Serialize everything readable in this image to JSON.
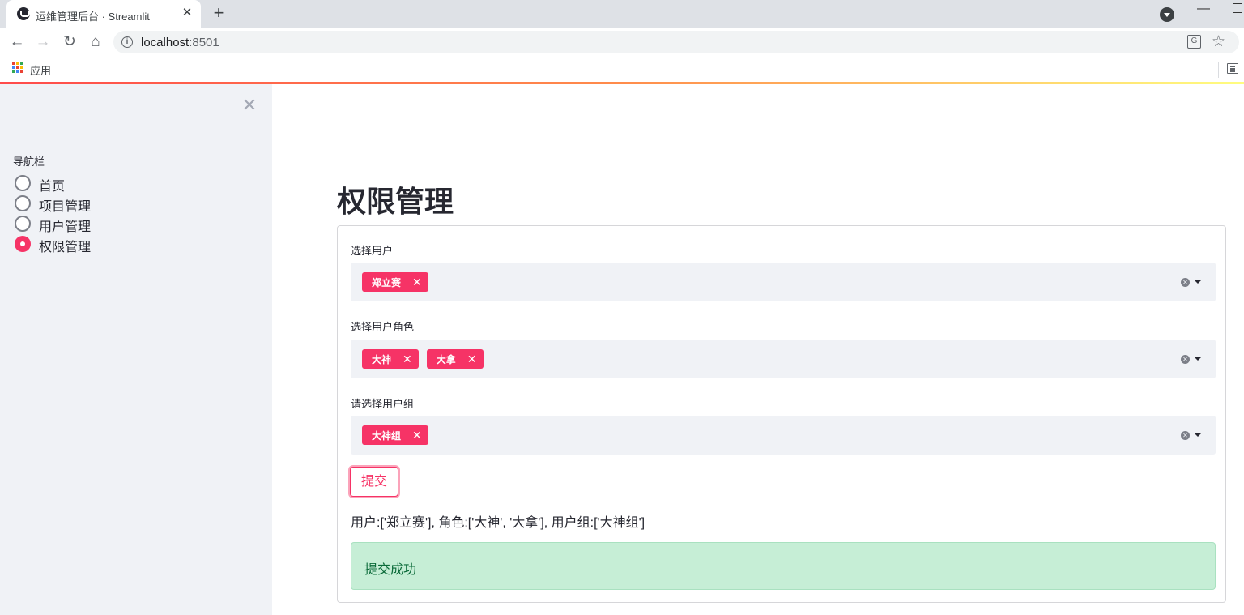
{
  "browser": {
    "tab_title": "运维管理后台 · Streamlit",
    "tab_close": "✕",
    "new_tab": "+",
    "url_host": "localhost",
    "url_port": ":8501",
    "bookmarks_apps_label": "应用",
    "apps_colors": [
      "#ea4335",
      "#fbbc05",
      "#34a853",
      "#4285f4",
      "#ea4335",
      "#fbbc05",
      "#34a853",
      "#4285f4",
      "#ea4335"
    ]
  },
  "sidebar": {
    "close": "✕",
    "radio_label": "导航栏",
    "items": [
      {
        "label": "首页",
        "checked": false
      },
      {
        "label": "项目管理",
        "checked": false
      },
      {
        "label": "用户管理",
        "checked": false
      },
      {
        "label": "权限管理",
        "checked": true
      }
    ]
  },
  "main": {
    "title": "权限管理",
    "fields": [
      {
        "label": "选择用户",
        "tags": [
          "郑立赛"
        ]
      },
      {
        "label": "选择用户角色",
        "tags": [
          "大神",
          "大拿"
        ]
      },
      {
        "label": "请选择用户组",
        "tags": [
          "大神组"
        ]
      }
    ],
    "submit_label": "提交",
    "result_text": "用户:['郑立赛'], 角色:['大神', '大拿'], 用户组:['大神组']",
    "success_text": "提交成功"
  },
  "colors": {
    "primary": "#f63366",
    "success_bg": "#c6eed6",
    "sidebar_bg": "#f0f2f6"
  }
}
